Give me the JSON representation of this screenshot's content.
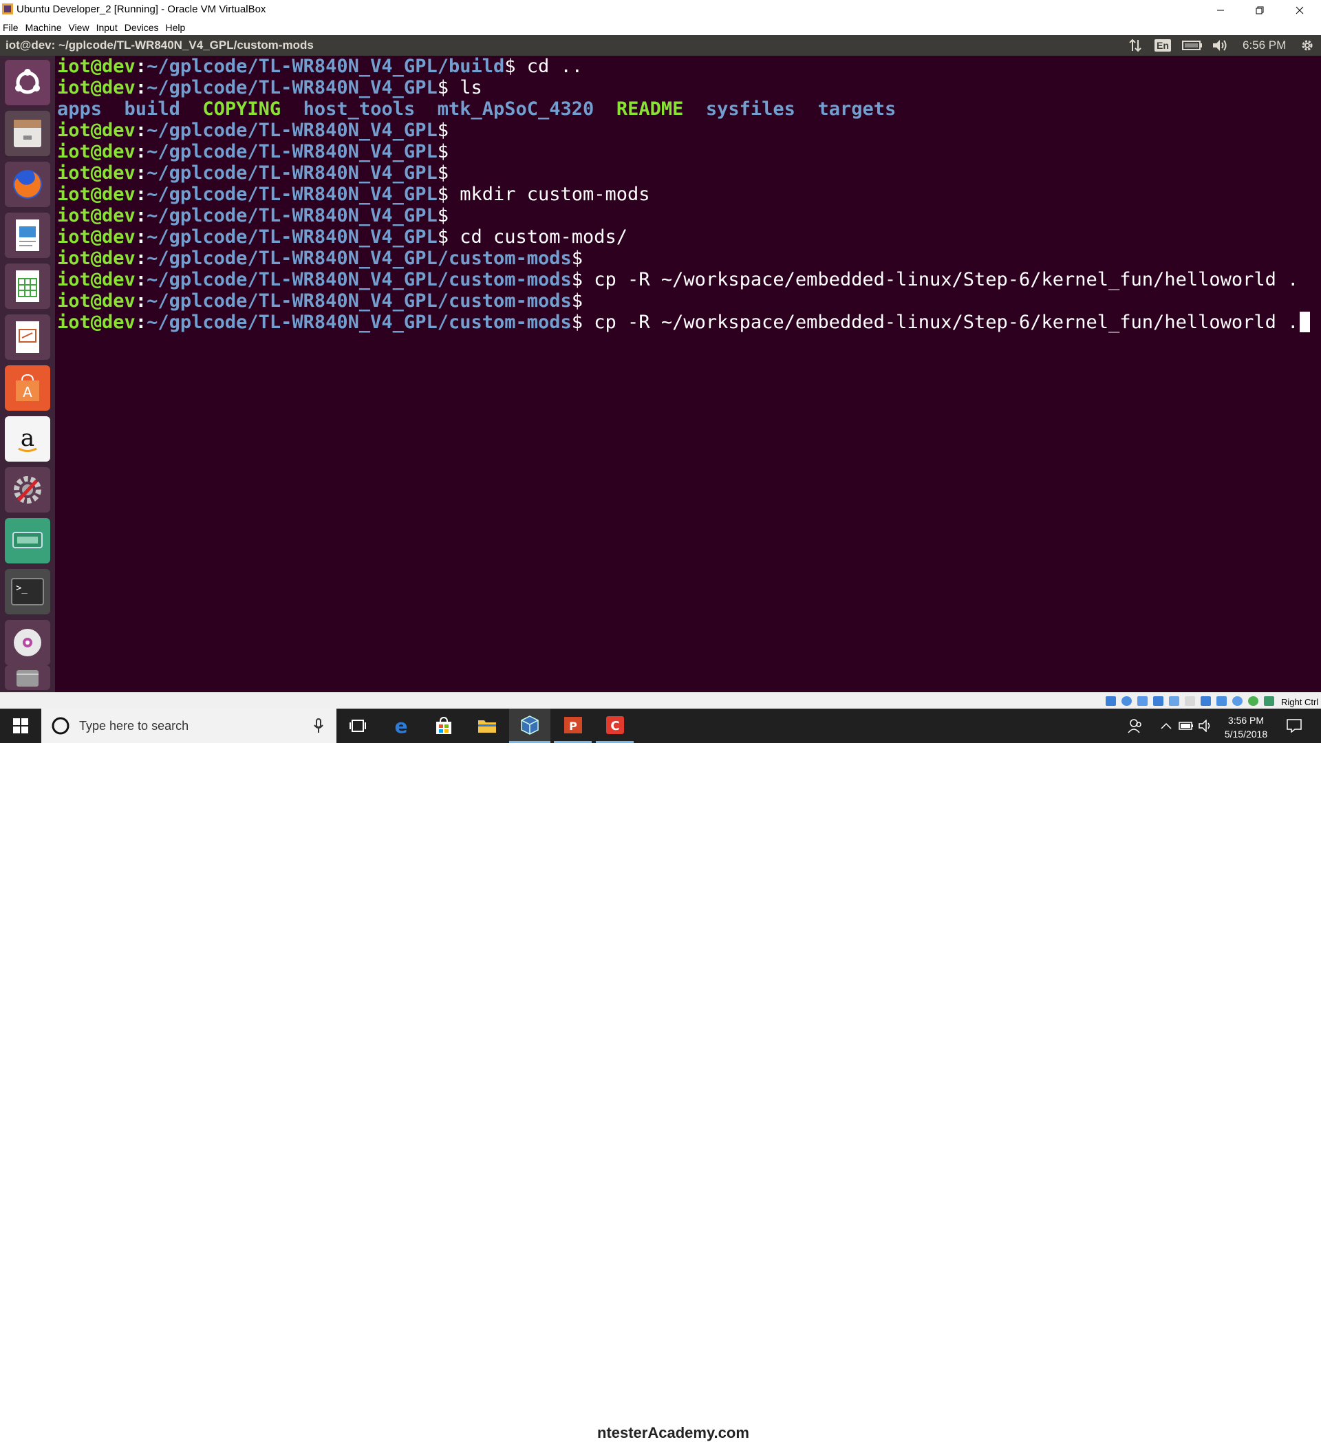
{
  "window": {
    "title": "Ubuntu Developer_2 [Running] - Oracle VM VirtualBox",
    "menu": [
      "File",
      "Machine",
      "View",
      "Input",
      "Devices",
      "Help"
    ]
  },
  "ubuntu_panel": {
    "title": "iot@dev: ~/gplcode/TL-WR840N_V4_GPL/custom-mods",
    "keyboard": "En",
    "time": "6:56 PM"
  },
  "launcher": {
    "items": [
      "ubuntu-dash",
      "files",
      "firefox",
      "libreoffice-writer",
      "libreoffice-calc",
      "libreoffice-impress",
      "ubuntu-software",
      "amazon",
      "system-settings",
      "network-device",
      "terminal",
      "dvd",
      "trash"
    ]
  },
  "terminal": {
    "lines": [
      {
        "user": "iot@dev",
        "sep": ":",
        "path": "~/gplcode/TL-WR840N_V4_GPL/build",
        "cmd": "$ cd .."
      },
      {
        "user": "iot@dev",
        "sep": ":",
        "path": "~/gplcode/TL-WR840N_V4_GPL",
        "cmd": "$ ls"
      },
      {
        "ls": [
          "apps",
          "build",
          "COPYING",
          "host_tools",
          "mtk_ApSoC_4320",
          "README",
          "sysfiles",
          "targets"
        ]
      },
      {
        "user": "iot@dev",
        "sep": ":",
        "path": "~/gplcode/TL-WR840N_V4_GPL",
        "cmd": "$"
      },
      {
        "user": "iot@dev",
        "sep": ":",
        "path": "~/gplcode/TL-WR840N_V4_GPL",
        "cmd": "$"
      },
      {
        "user": "iot@dev",
        "sep": ":",
        "path": "~/gplcode/TL-WR840N_V4_GPL",
        "cmd": "$"
      },
      {
        "user": "iot@dev",
        "sep": ":",
        "path": "~/gplcode/TL-WR840N_V4_GPL",
        "cmd": "$ mkdir custom-mods"
      },
      {
        "user": "iot@dev",
        "sep": ":",
        "path": "~/gplcode/TL-WR840N_V4_GPL",
        "cmd": "$"
      },
      {
        "user": "iot@dev",
        "sep": ":",
        "path": "~/gplcode/TL-WR840N_V4_GPL",
        "cmd": "$ cd custom-mods/"
      },
      {
        "user": "iot@dev",
        "sep": ":",
        "path": "~/gplcode/TL-WR840N_V4_GPL/custom-mods",
        "cmd": "$"
      },
      {
        "user": "iot@dev",
        "sep": ":",
        "path": "~/gplcode/TL-WR840N_V4_GPL/custom-mods",
        "cmd": "$ cp -R ~/workspace/embedded-linux/Step-6/kernel_fun/helloworld ."
      },
      {
        "user": "iot@dev",
        "sep": ":",
        "path": "~/gplcode/TL-WR840N_V4_GPL/custom-mods",
        "cmd": "$"
      },
      {
        "user": "iot@dev",
        "sep": ":",
        "path": "~/gplcode/TL-WR840N_V4_GPL/custom-mods",
        "cmd": "$ cp -R ~/workspace/embedded-linux/Step-6/kernel_fun/helloworld ."
      }
    ]
  },
  "vb_status": {
    "host_key": "Right Ctrl"
  },
  "taskbar": {
    "search_placeholder": "Type here to search",
    "watermark": "ntesterAcademy.com",
    "time": "3:56 PM",
    "date": "5/15/2018"
  },
  "colors": {
    "terminal_bg": "#2c001e",
    "prompt_user": "#8ae234",
    "prompt_path": "#729fcf",
    "launcher_bg": "#3d2438",
    "panel_bg": "#3c3b37"
  }
}
